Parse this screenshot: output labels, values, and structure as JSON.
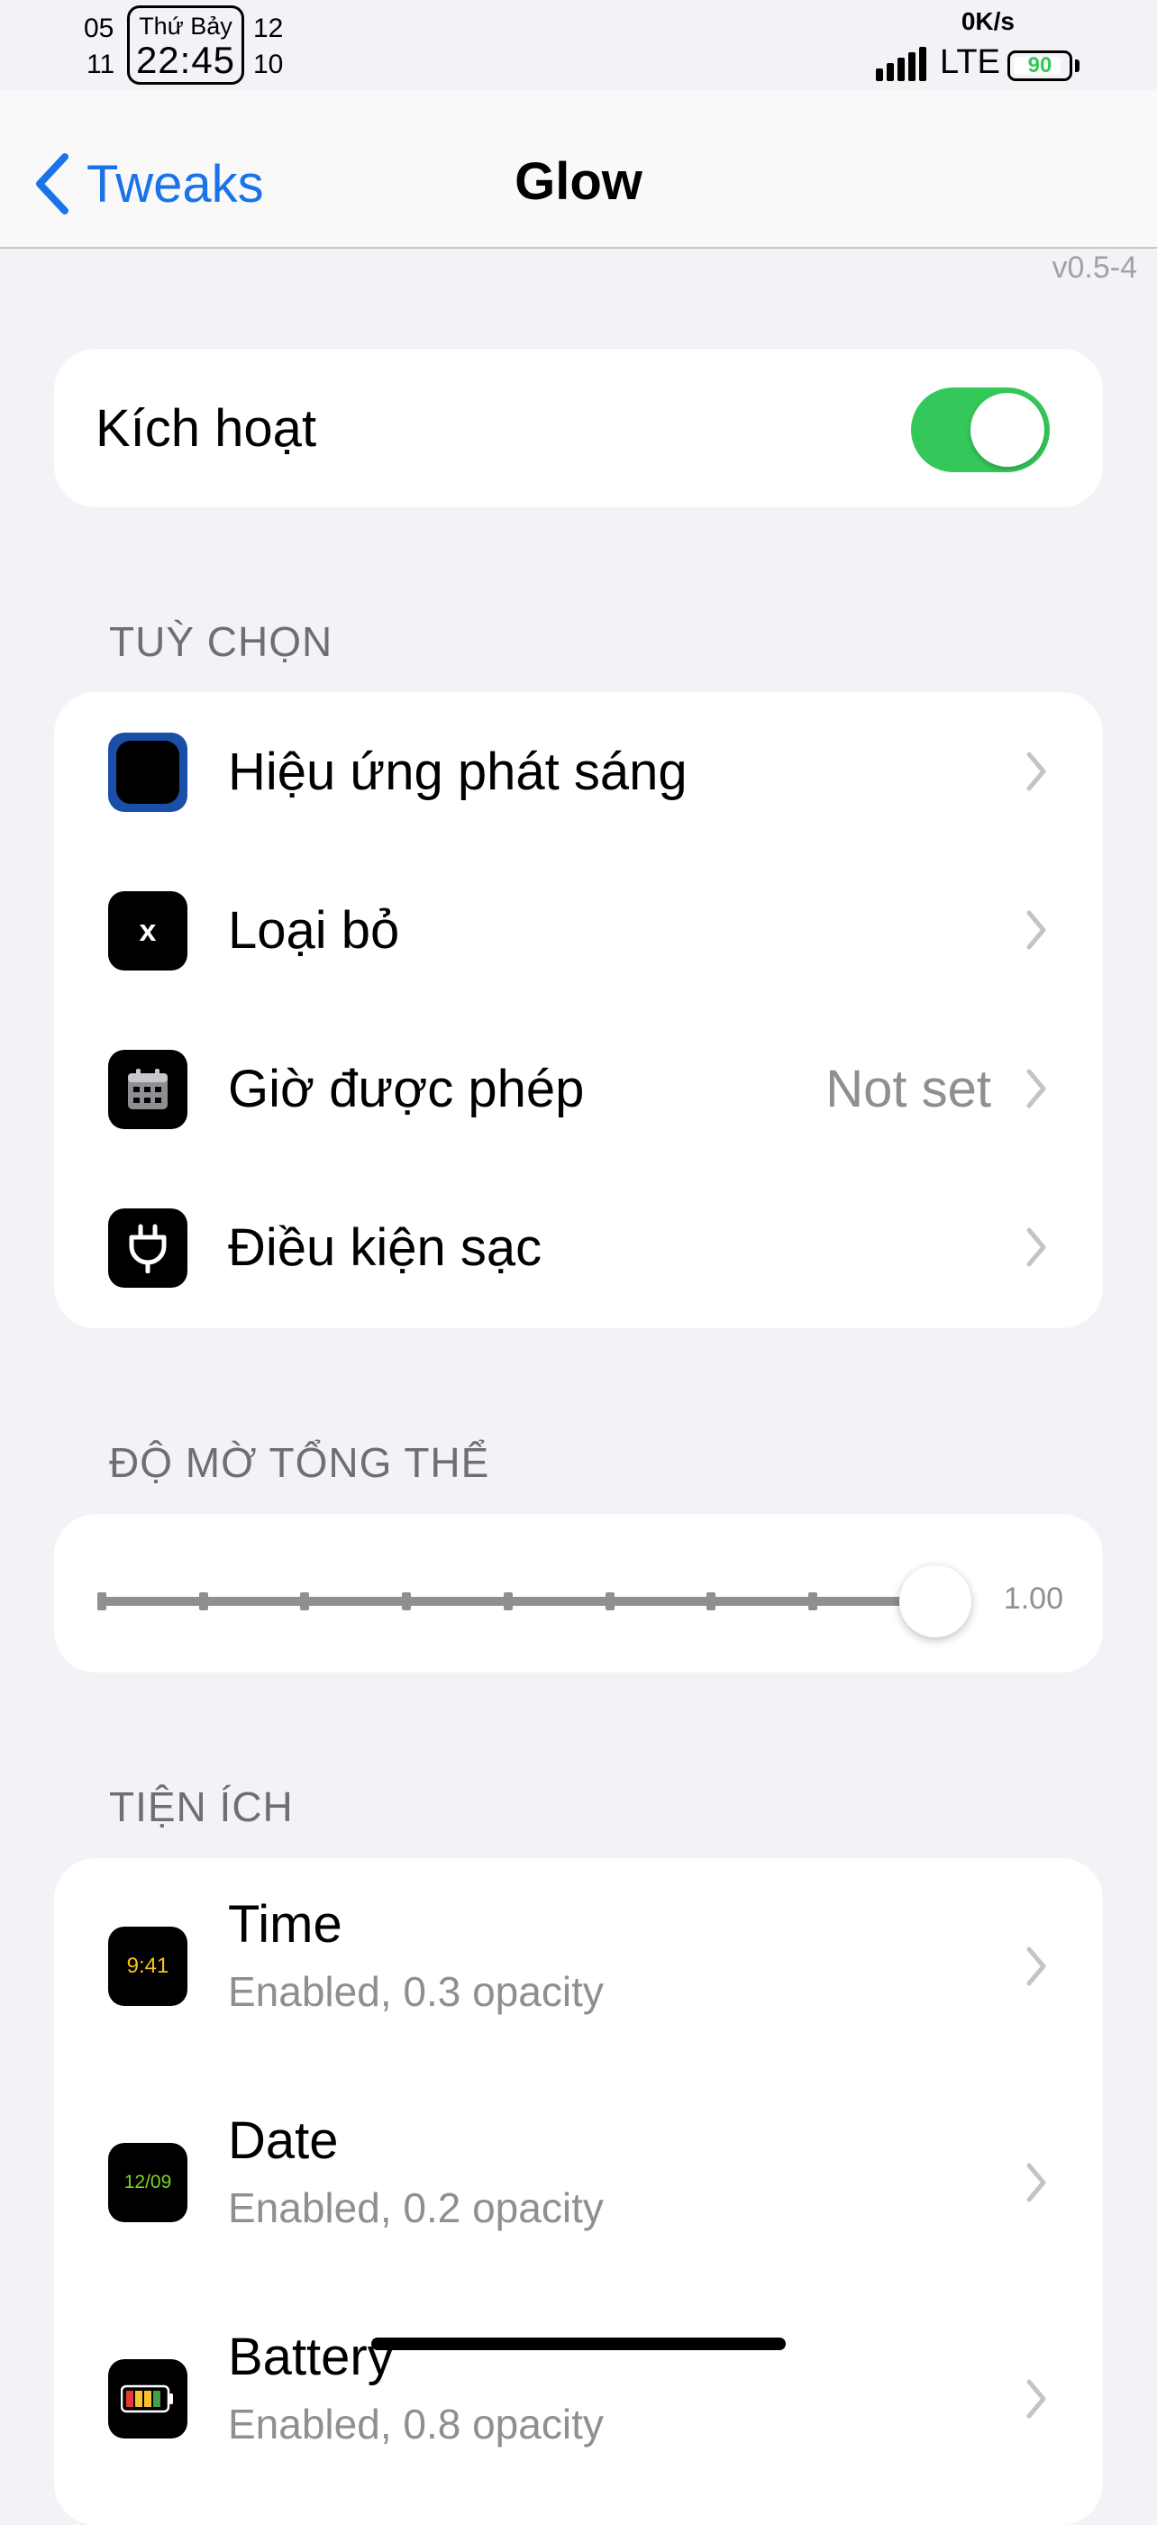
{
  "status_bar": {
    "date_left_top": "05",
    "date_left_bottom": "11",
    "day": "Thứ Bảy",
    "time": "22:45",
    "date_right_top": "12",
    "date_right_bottom": "10",
    "net_speed": "0K/s",
    "carrier": "LTE",
    "battery": "90",
    "battery_level": 0.9
  },
  "nav": {
    "back_label": "Tweaks",
    "title": "Glow"
  },
  "version": "v0.5-4",
  "enable": {
    "label": "Kích hoạt",
    "on": true
  },
  "options": {
    "header": "TUỲ CHỌN",
    "items": [
      {
        "label": "Hiệu ứng phát sáng",
        "icon": "glow-icon"
      },
      {
        "label": "Loại bỏ",
        "icon": "x-icon"
      },
      {
        "label": "Giờ được phép",
        "icon": "calendar-icon",
        "value": "Not set"
      },
      {
        "label": "Điều kiện sạc",
        "icon": "plug-icon"
      }
    ]
  },
  "opacity": {
    "header": "ĐỘ MỜ TỔNG THỂ",
    "value_label": "1.00",
    "value": 1.0
  },
  "widgets": {
    "header": "TIỆN ÍCH",
    "items": [
      {
        "label": "Time",
        "sub": "Enabled, 0.3 opacity",
        "icon_text": "9:41",
        "icon_color": "#f5c518"
      },
      {
        "label": "Date",
        "sub": "Enabled, 0.2 opacity",
        "icon_text": "12/09",
        "icon_color": "#7ed321"
      },
      {
        "label": "Battery",
        "sub": "Enabled, 0.8 opacity",
        "icon": "battery-bars-icon"
      }
    ]
  },
  "colors": {
    "accent": "#1a73e8",
    "toggle_on": "#34c759",
    "background": "#f2f2f7"
  }
}
